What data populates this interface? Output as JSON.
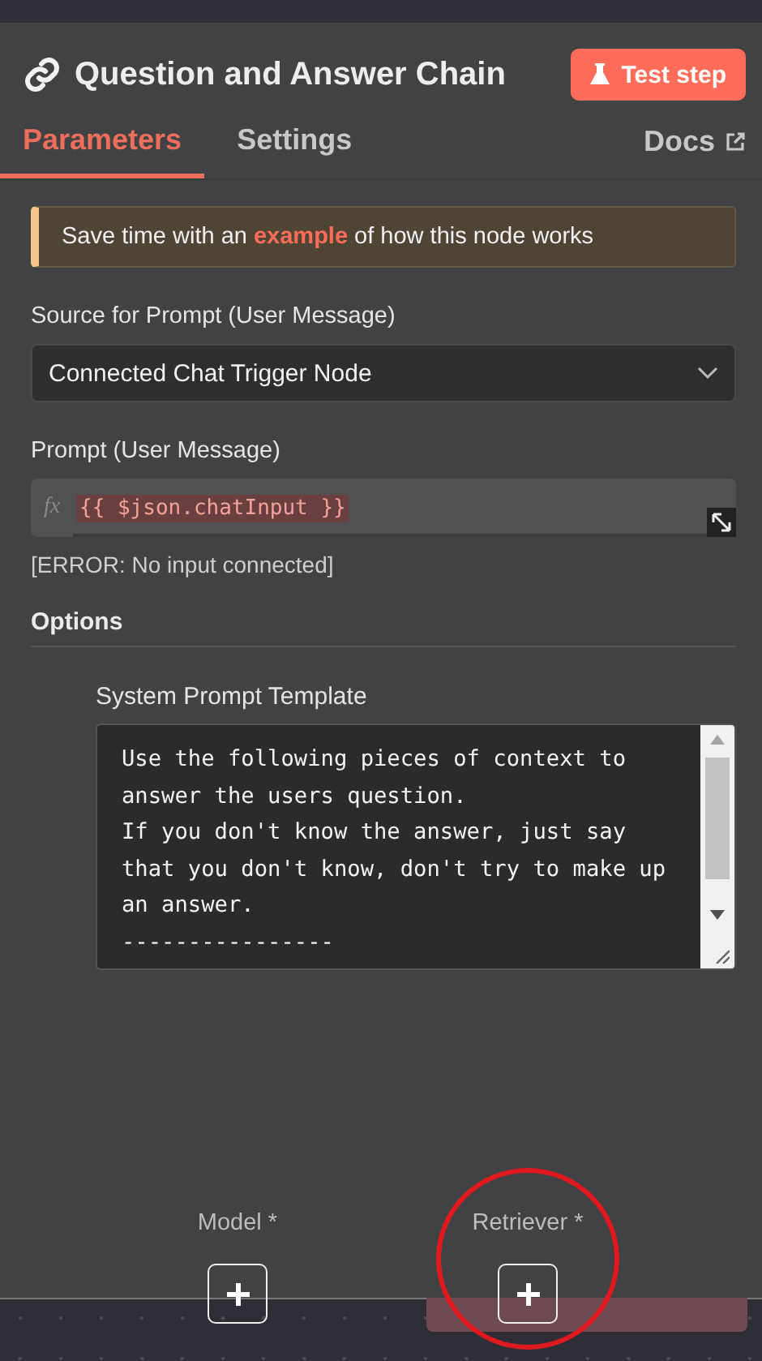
{
  "header": {
    "title": "Question and Answer Chain",
    "test_button": "Test step"
  },
  "tabs": [
    {
      "label": "Parameters",
      "selected": true
    },
    {
      "label": "Settings",
      "selected": false
    }
  ],
  "docs_link": "Docs",
  "notice": {
    "before": "Save time with an",
    "link": "example",
    "after": "of how this node works"
  },
  "fields": [
    {
      "kind": "select",
      "label": "Source for Prompt (User Message)",
      "value": "Connected Chat Trigger Node"
    },
    {
      "kind": "expression",
      "label": "Prompt (User Message)",
      "prefix": "fx",
      "value": "{{ $json.chatInput }}",
      "error": "[ERROR: No input connected]"
    }
  ],
  "options": {
    "title": "Options",
    "items": [
      {
        "label": "System Prompt Template",
        "lines": [
          "Use the following pieces of context to",
          "answer the users question.",
          "If you don't know the answer, just say",
          "that you don't know, don't try to make up",
          "an answer.",
          "----------------"
        ]
      }
    ]
  },
  "connectors": [
    {
      "label": "Model *",
      "highlighted": false
    },
    {
      "label": "Retriever *",
      "highlighted": true
    }
  ]
}
